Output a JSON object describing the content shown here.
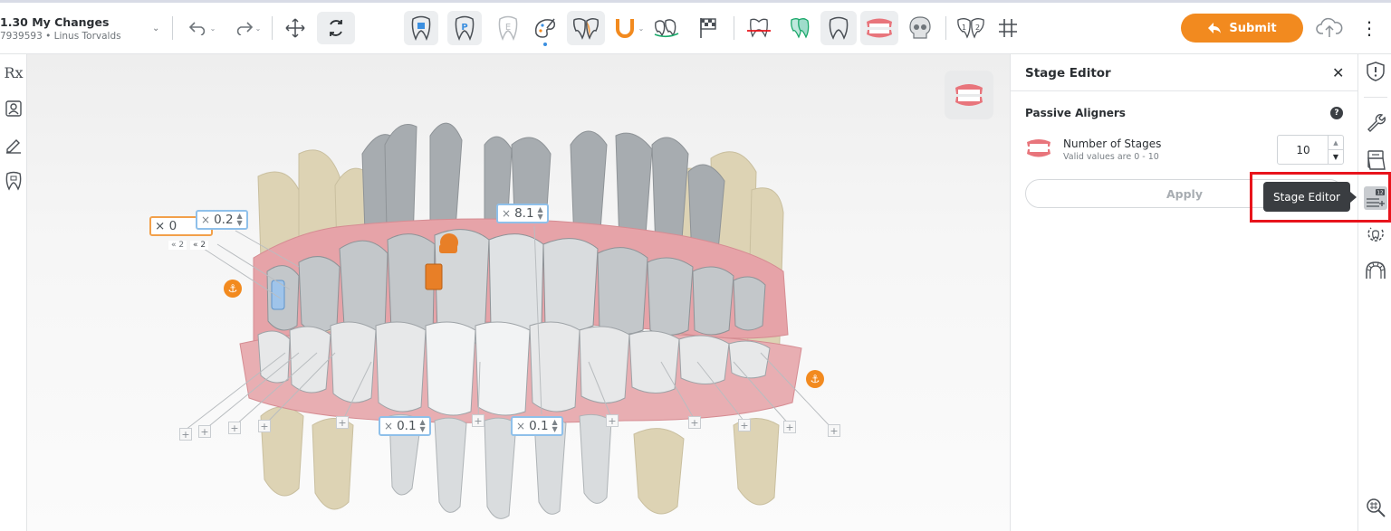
{
  "header": {
    "case_title": "1.30 My Changes",
    "case_sub": "7939593 • Linus Torvalds",
    "submit_label": "Submit"
  },
  "panel": {
    "title": "Stage Editor",
    "close_icon": "close-icon",
    "section_title": "Passive Aligners",
    "stages_label": "Number of Stages",
    "stages_hint": "Valid values are 0 - 10",
    "stages_value": "10",
    "apply_label": "Apply"
  },
  "tooltip": {
    "text": "Stage Editor"
  },
  "left_rail": {
    "rx_label": "Rx"
  },
  "measurements": [
    {
      "prefix": "×",
      "value": "0.2"
    },
    {
      "prefix": "×",
      "value": "8.1"
    },
    {
      "prefix": "×",
      "value": "0.1"
    },
    {
      "prefix": "×",
      "value": "0.1"
    }
  ],
  "orange_labels": [
    "× 0",
    "« 2",
    "« 2"
  ],
  "colors": {
    "accent": "#f28a1f",
    "highlight": "#e8141c",
    "measure_border": "#8fc0ea",
    "gum": "#e6a3a8"
  }
}
